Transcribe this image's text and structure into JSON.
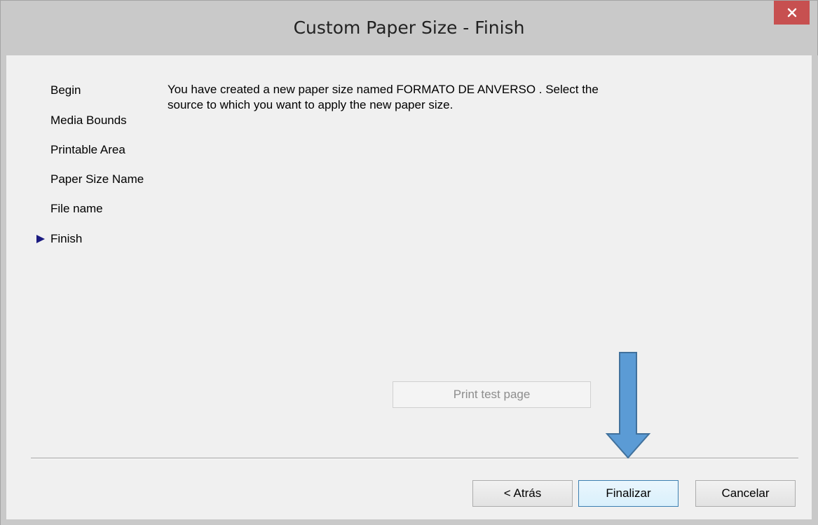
{
  "window": {
    "title": "Custom Paper Size - Finish",
    "close_glyph": "✕"
  },
  "steps": [
    {
      "label": "Begin",
      "current": false
    },
    {
      "label": "Media Bounds",
      "current": false
    },
    {
      "label": "Printable Area",
      "current": false
    },
    {
      "label": "Paper Size Name",
      "current": false
    },
    {
      "label": "File name",
      "current": false
    },
    {
      "label": "Finish",
      "current": true
    }
  ],
  "description": "You have created a new paper size named FORMATO DE ANVERSO . Select the source to which you want to apply the new paper size.",
  "print_test_button": "Print test page",
  "footer": {
    "back_button": "< Atrás",
    "finish_button": "Finalizar",
    "cancel_button": "Cancelar"
  },
  "colors": {
    "titlebar": "#c9c9c9",
    "close_button": "#c75050",
    "current_step_arrow": "#1a1a80",
    "annotation_arrow_fill": "#5b9bd5",
    "annotation_arrow_stroke": "#41719c"
  },
  "icons": {
    "close": "close-icon",
    "current_step": "step-pointer-icon",
    "annotation": "down-arrow-annotation"
  }
}
